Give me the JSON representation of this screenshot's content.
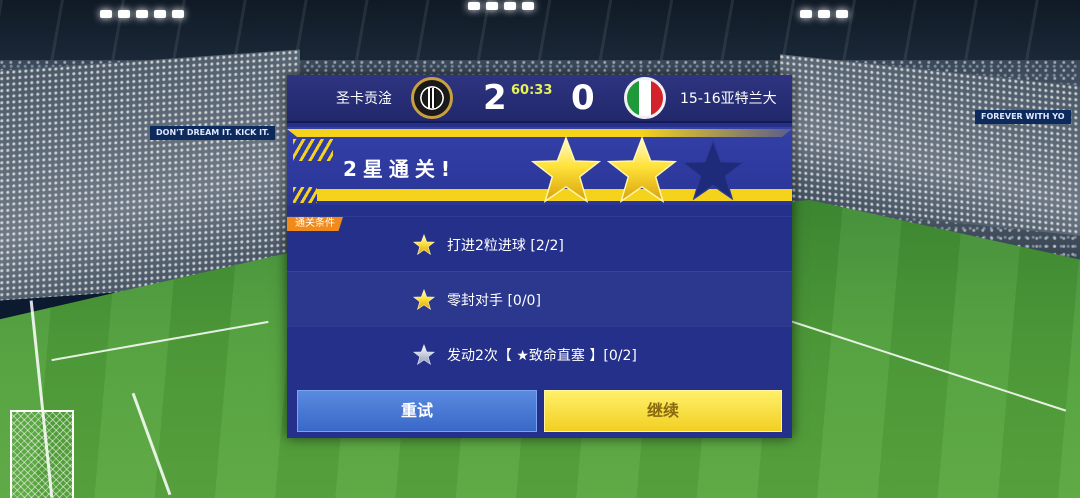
{
  "background": {
    "banner_left": "DON'T DREAM IT. KICK IT.",
    "banner_right": "FOREVER WITH YO"
  },
  "match": {
    "home_team": "圣卡贡淦",
    "away_team": "15-16亚特兰大",
    "home_score": "2",
    "away_score": "0",
    "time_minutes": "60",
    "time_separator": ":",
    "time_seconds": "33"
  },
  "result": {
    "title": "2星通关!",
    "stars_earned": 2,
    "stars_total": 3
  },
  "conditions": {
    "tag": "通关条件",
    "items": [
      {
        "text": "打进2粒进球 [2/2]",
        "achieved": true
      },
      {
        "text": "零封对手 [0/0]",
        "achieved": true
      },
      {
        "text": "发动2次【 ★致命直塞 】[0/2]",
        "achieved": false
      }
    ]
  },
  "buttons": {
    "retry_label": "重试",
    "continue_label": "继续"
  },
  "colors": {
    "panel": "#24308a",
    "star_gold": "#f5d21c",
    "star_empty": "#1e2a7a",
    "tag_orange": "#f08a1a",
    "retry_blue": "#4a78d8",
    "continue_yellow": "#f5d92a"
  }
}
